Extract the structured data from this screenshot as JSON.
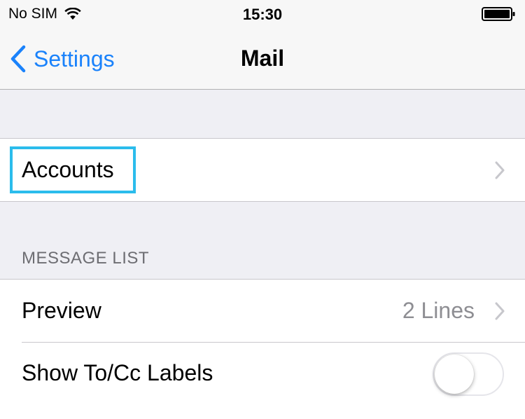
{
  "status_bar": {
    "carrier": "No SIM",
    "time": "15:30"
  },
  "nav": {
    "back_label": "Settings",
    "title": "Mail"
  },
  "accounts": {
    "label": "Accounts"
  },
  "message_list": {
    "header": "MESSAGE LIST",
    "preview": {
      "label": "Preview",
      "value": "2 Lines"
    },
    "show_to_cc": {
      "label": "Show To/Cc Labels",
      "enabled": false
    }
  },
  "colors": {
    "accent": "#1a82fb",
    "highlight": "#2bbcec",
    "background": "#efeff4"
  }
}
